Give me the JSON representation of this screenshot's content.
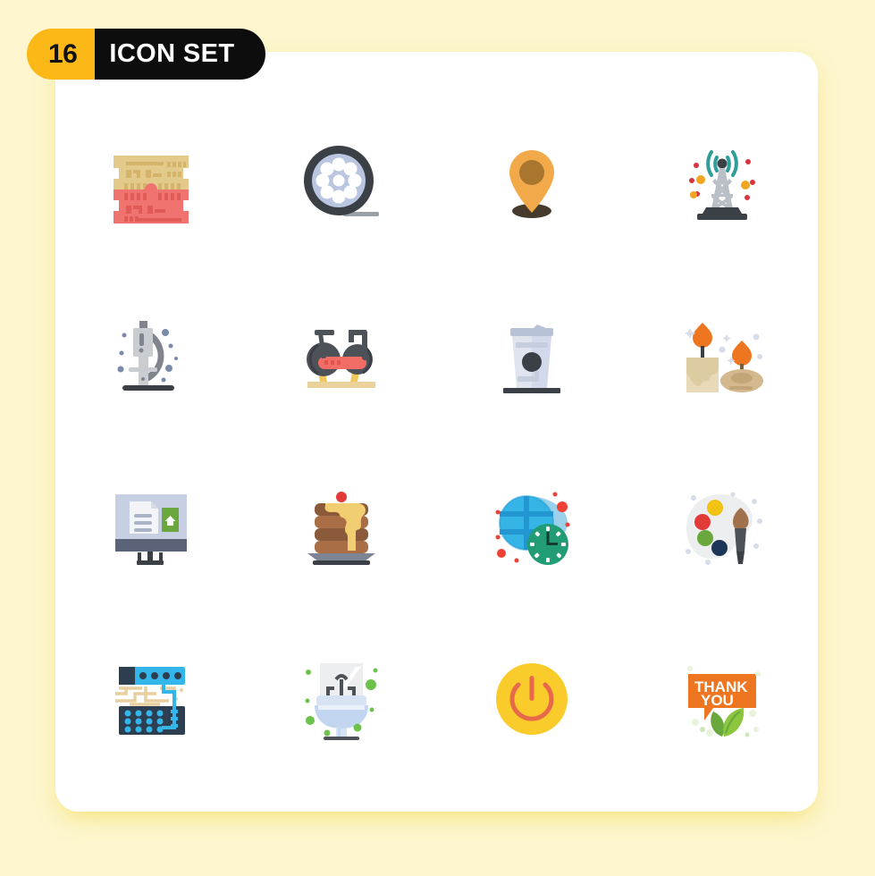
{
  "badge": {
    "count": "16",
    "label": "ICON SET"
  },
  "page": {
    "background_color": "#fdf6ce",
    "card_color": "#ffffff",
    "badge_count_color": "#fbb816",
    "badge_label_color": "#0d0d0d"
  },
  "grid": {
    "columns": 4,
    "rows": 4,
    "icons": [
      {
        "name": "ram-memory-icon",
        "label": "RAM Memory Modules",
        "colors": [
          "#e3c98a",
          "#f0736f"
        ]
      },
      {
        "name": "film-reel-icon",
        "label": "Film Reel",
        "colors": [
          "#3b3f46",
          "#bac6e0",
          "#ffffff"
        ]
      },
      {
        "name": "map-pin-icon",
        "label": "Map Location Pin",
        "colors": [
          "#f2a949",
          "#a9762f",
          "#463a2c"
        ]
      },
      {
        "name": "signal-tower-icon",
        "label": "Signal Tower",
        "colors": [
          "#2f9e9a",
          "#b9bfc6",
          "#3b3f46",
          "#d7343f",
          "#f2a521"
        ]
      },
      {
        "name": "microscope-icon",
        "label": "Microscope",
        "colors": [
          "#c9ccd1",
          "#80848c",
          "#3b3f46",
          "#7a8aa8"
        ]
      },
      {
        "name": "exercise-bike-icon",
        "label": "Exercise Bike",
        "colors": [
          "#4d5158",
          "#f26d66",
          "#f2c75c",
          "#ead29a"
        ]
      },
      {
        "name": "soda-cup-icon",
        "label": "Soda Drink Cup",
        "colors": [
          "#dfe4ef",
          "#b8c2d6",
          "#3b3f46"
        ]
      },
      {
        "name": "candles-icon",
        "label": "Candles",
        "colors": [
          "#e8d9b9",
          "#d4b98e",
          "#ef7620",
          "#3b3f46"
        ]
      },
      {
        "name": "presentation-icon",
        "label": "Presentation Monitor",
        "colors": [
          "#c7cfe2",
          "#5a6377",
          "#ffffff",
          "#6aa83d"
        ]
      },
      {
        "name": "pancakes-icon",
        "label": "Pancakes with Syrup",
        "colors": [
          "#8a5a3b",
          "#a96e45",
          "#f2ce72",
          "#e23b37",
          "#7d8594"
        ]
      },
      {
        "name": "globe-clock-icon",
        "label": "Globe with Clock",
        "colors": [
          "#35b5e5",
          "#2196d1",
          "#229c75",
          "#ffffff",
          "#ef4136"
        ]
      },
      {
        "name": "paint-palette-icon",
        "label": "Paint Palette",
        "colors": [
          "#eceef0",
          "#f2c313",
          "#e23b37",
          "#6aa83d",
          "#1d3557",
          "#a0714a"
        ]
      },
      {
        "name": "circuit-board-icon",
        "label": "Circuit Board Server",
        "colors": [
          "#2d3e50",
          "#34b6ea",
          "#e8cfa0"
        ]
      },
      {
        "name": "bathroom-sink-icon",
        "label": "Bathroom Sink",
        "colors": [
          "#d6e3f5",
          "#eceef0",
          "#4d5158",
          "#6dc24b"
        ]
      },
      {
        "name": "power-button-icon",
        "label": "Power Button",
        "colors": [
          "#f9cc2b",
          "#e8694a"
        ]
      },
      {
        "name": "thank-you-icon",
        "label": "Thank You Speech Bubble",
        "colors": [
          "#ef7620",
          "#ffffff",
          "#6aa83d",
          "#8cc63f"
        ],
        "text": "THANK YOU"
      }
    ]
  }
}
